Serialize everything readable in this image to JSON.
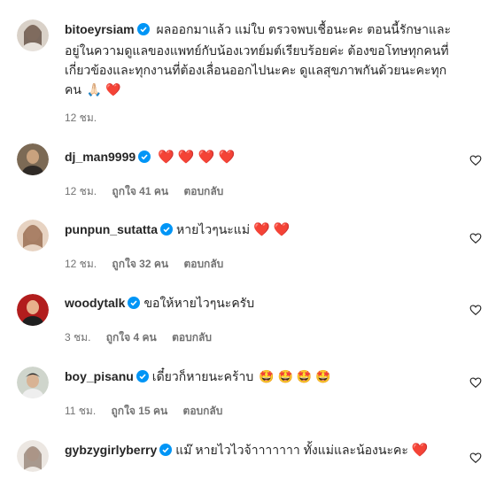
{
  "post": {
    "username": "bitoeyrsiam",
    "caption_lines": [
      "ผลออกมาแล้ว แม่ใบ ตรวจพบเชื้อนะคะ ตอนนี้รักษาและ",
      "อยู่ในความดูแลของแพทย์กับน้องเวทย์มต์เรียบร้อยค่ะ ต้องขอโทษทุกคนที่",
      "เกี่ยวข้องและทุกงานที่ต้องเลื่อนออกไปนะคะ ดูแลสุขภาพกันด้วยนะคะทุก",
      "คน"
    ],
    "caption_emoji": "🙏🏻 ❤️",
    "time": "12 ชม."
  },
  "comments": [
    {
      "username": "dj_man9999",
      "verified": true,
      "text": "",
      "hearts": "❤️ ❤️ ❤️ ❤️",
      "time": "12 ชม.",
      "likes": "ถูกใจ 41 คน",
      "reply": "ตอบกลับ"
    },
    {
      "username": "punpun_sutatta",
      "verified": true,
      "text": "หายไวๆนะแม่",
      "hearts": "❤️ ❤️",
      "time": "12 ชม.",
      "likes": "ถูกใจ 32 คน",
      "reply": "ตอบกลับ"
    },
    {
      "username": "woodytalk",
      "verified": true,
      "text": "ขอให้หายไวๆนะครับ",
      "hearts": "",
      "time": "3 ชม.",
      "likes": "ถูกใจ 4 คน",
      "reply": "ตอบกลับ"
    },
    {
      "username": "boy_pisanu",
      "verified": true,
      "text": "เดี๋ยวก็หายนะคร้าบ",
      "hearts": "🤩 🤩 🤩 🤩",
      "time": "11 ชม.",
      "likes": "ถูกใจ 15 คน",
      "reply": "ตอบกลับ"
    },
    {
      "username": "gybzygirlyberry",
      "verified": true,
      "text": "แม๊ หายไวไวจ้าาาาาาา ทั้งแม่และน้องนะคะ",
      "hearts": "❤️",
      "time": "",
      "likes": "",
      "reply": ""
    }
  ],
  "colors": {
    "text": "#262626",
    "meta": "#737373",
    "verified_badge": "#0095f6",
    "heart": "#e01b3a"
  }
}
